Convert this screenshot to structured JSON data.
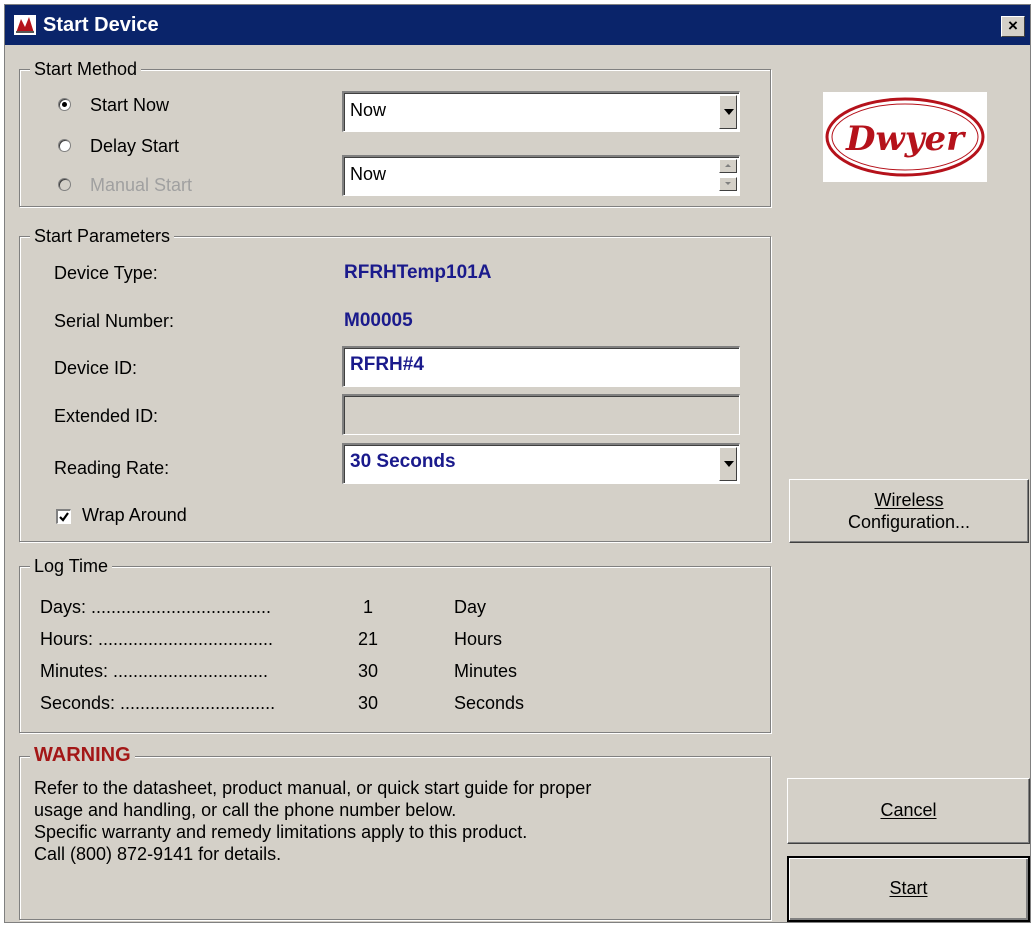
{
  "window": {
    "title": "Start Device",
    "close_label": "×"
  },
  "start_method": {
    "legend": "Start Method",
    "options": [
      {
        "label": "Start Now",
        "selected": true,
        "enabled": true
      },
      {
        "label": "Delay Start",
        "selected": false,
        "enabled": true
      },
      {
        "label": "Manual Start",
        "selected": false,
        "enabled": false
      }
    ],
    "start_now_value": "Now",
    "delay_value": "Now"
  },
  "logo": {
    "text": "Dwyer",
    "color": "#b5121b"
  },
  "start_parameters": {
    "legend": "Start Parameters",
    "device_type_label": "Device Type:",
    "device_type_value": "RFRHTemp101A",
    "serial_number_label": "Serial Number:",
    "serial_number_value": "M00005",
    "device_id_label": "Device ID:",
    "device_id_value": "RFRH#4",
    "extended_id_label": "Extended ID:",
    "extended_id_value": "",
    "reading_rate_label": "Reading Rate:",
    "reading_rate_value": "30 Seconds",
    "wrap_around_label": "Wrap Around",
    "wrap_around_checked": true
  },
  "log_time": {
    "legend": "Log Time",
    "rows": [
      {
        "label": "Days: ....................................",
        "value": "1",
        "unit": "Day"
      },
      {
        "label": "Hours: ...................................",
        "value": "21",
        "unit": "Hours"
      },
      {
        "label": "Minutes: ...............................",
        "value": "30",
        "unit": "Minutes"
      },
      {
        "label": "Seconds: ...............................",
        "value": "30",
        "unit": "Seconds"
      }
    ]
  },
  "warning": {
    "legend": "WARNING",
    "lines": [
      "Refer to the datasheet, product manual, or quick start guide for proper",
      "usage and handling, or call the phone number below.",
      "Specific warranty and remedy limitations apply to this product.",
      "Call (800) 872-9141 for details."
    ]
  },
  "buttons": {
    "wireless_line1": "Wireless",
    "wireless_line2": "Configuration...",
    "cancel": "Cancel",
    "start": "Start"
  },
  "colors": {
    "titlebar": "#0a246a",
    "dialog_bg": "#d4d0c8",
    "value_blue": "#1a1a8c",
    "warning_red": "#a31717"
  }
}
